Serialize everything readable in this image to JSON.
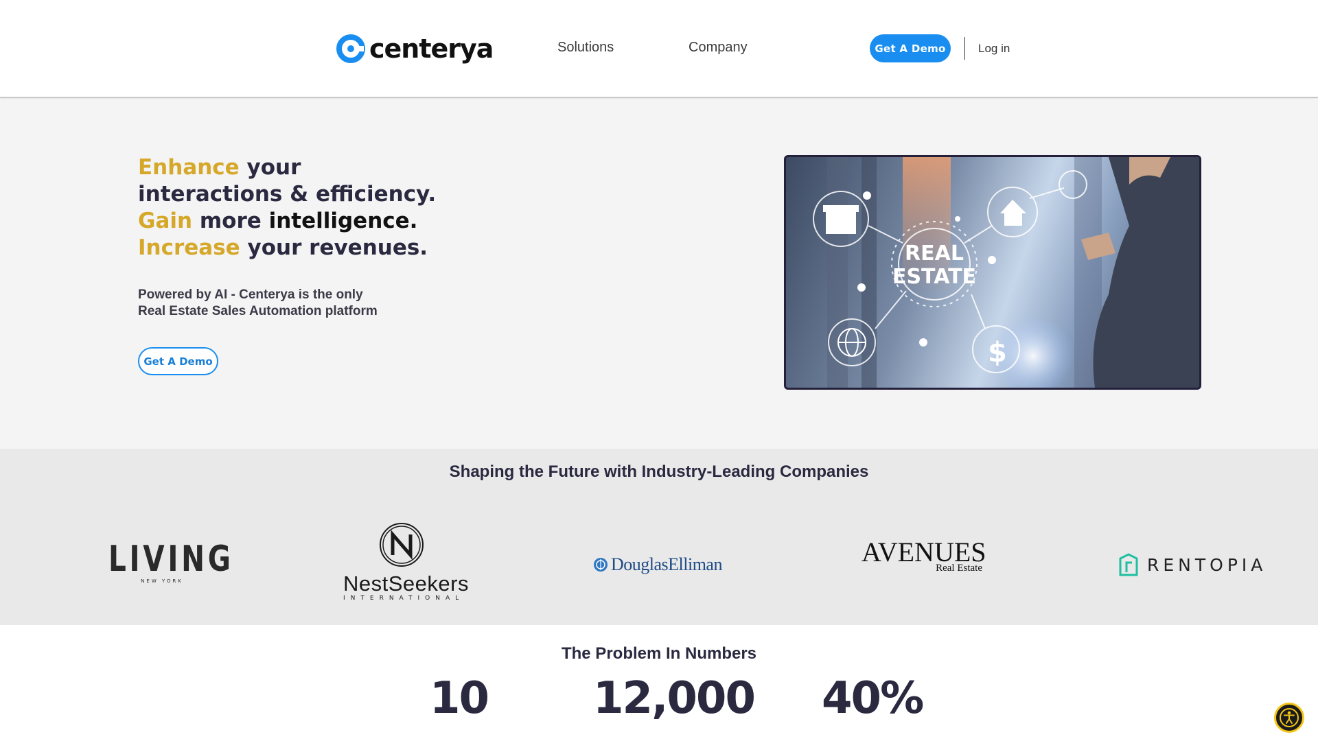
{
  "header": {
    "logo_text": "centerya",
    "nav": {
      "solutions": "Solutions",
      "company": "Company"
    },
    "demo_button": "Get A Demo",
    "login": "Log in",
    "brand_color": "#1a8ef0"
  },
  "hero": {
    "headline": {
      "l1_accent": "Enhance",
      "l1_rest": " your",
      "l2": "interactions & efficiency.",
      "l3_accent": "Gain",
      "l3_mid": " more ",
      "l3_strong": "intelligence.",
      "l4_accent": "Increase",
      "l4_rest": " your revenues."
    },
    "subtitle_line1": "Powered by AI - Centerya is the only",
    "subtitle_line2": "Real Estate Sales Automation platform",
    "demo_button": "Get A Demo",
    "image_text_1": "REAL",
    "image_text_2": "ESTATE",
    "accent_color": "#d6a82a"
  },
  "partners": {
    "title": "Shaping the Future with Industry-Leading Companies",
    "living": {
      "main": "LIVING",
      "sub": "NEW YORK"
    },
    "nestseekers": {
      "main": "NestSeekers",
      "sub": "INTERNATIONAL"
    },
    "douglas": {
      "main": "DouglasElliman"
    },
    "avenues": {
      "main": "AVENUES",
      "sub": "Real Estate"
    },
    "rentopia": {
      "main": "RENTOPIA"
    }
  },
  "numbers": {
    "title": "The Problem In Numbers",
    "stats": [
      "10",
      "12,000",
      "40%"
    ]
  }
}
